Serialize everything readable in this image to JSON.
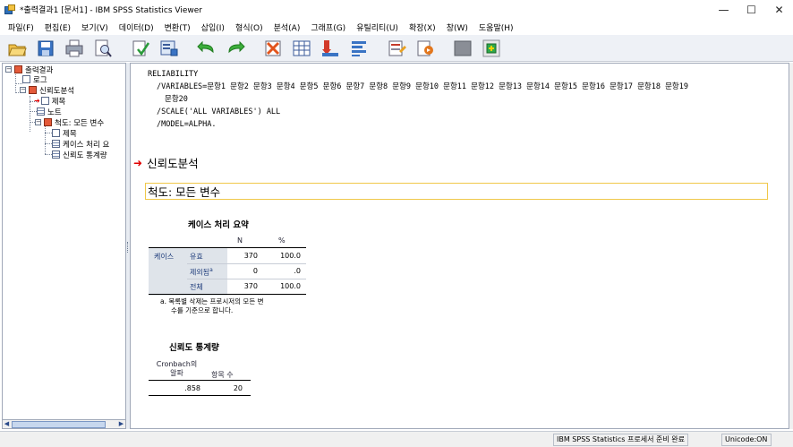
{
  "window": {
    "title": "*출력결과1 [문서1] - IBM SPSS Statistics Viewer",
    "minimize": "—",
    "maximize": "☐",
    "close": "✕"
  },
  "menu": [
    "파일(F)",
    "편집(E)",
    "보기(V)",
    "데이터(D)",
    "변환(T)",
    "삽입(I)",
    "형식(O)",
    "분석(A)",
    "그래프(G)",
    "유틸리티(U)",
    "확장(X)",
    "창(W)",
    "도움말(H)"
  ],
  "toolbar": {
    "icons": [
      "open-icon",
      "save-icon",
      "print-icon",
      "print-preview-icon",
      "export-icon",
      "recall-dialog-icon",
      "undo-icon",
      "redo-icon",
      "goto-data-icon",
      "goto-case-icon",
      "goto-variable-icon",
      "variables-icon",
      "insert-heading-icon",
      "insert-title-icon",
      "show-hide-icon",
      "designate-window-icon"
    ]
  },
  "nav": {
    "root": "출력결과",
    "log": "로그",
    "analysis": "신뢰도분석",
    "title": "제목",
    "notes": "노트",
    "scale": "척도: 모든 변수",
    "scale_title": "제목",
    "case_summary": "케이스 처리 요",
    "reliability_stats": "신뢰도 통계량"
  },
  "syntax": {
    "line1": "RELIABILITY",
    "line2": "/VARIABLES=문항1 문항2 문항3 문항4 문항5 문항6 문항7 문항8 문항9 문항10 문항11 문항12 문항13 문항14 문항15 문항16 문항17 문항18 문항19",
    "line3": "문항20",
    "line4": "/SCALE('ALL VARIABLES') ALL",
    "line5": "/MODEL=ALPHA."
  },
  "output": {
    "heading": "신뢰도분석",
    "scale_heading": "척도: 모든 변수",
    "case_table": {
      "title": "케이스 처리 요약",
      "col_n": "N",
      "col_pct": "%",
      "group_label": "케이스",
      "rows": [
        {
          "label": "유효",
          "n": "370",
          "pct": "100.0"
        },
        {
          "label": "제외됨",
          "superscript": "a",
          "n": "0",
          "pct": ".0"
        },
        {
          "label": "전체",
          "n": "370",
          "pct": "100.0"
        }
      ],
      "footnote_line1": "a. 목록별 삭제는 프로시저의 모든 변",
      "footnote_line2": "수를 기준으로 합니다."
    },
    "reliability_table": {
      "title": "신뢰도 통계량",
      "col_alpha_line1": "Cronbach의",
      "col_alpha_line2": "알파",
      "col_items": "항목 수",
      "alpha": ".858",
      "items": "20"
    }
  },
  "status": {
    "processor": "IBM SPSS Statistics 프로세서 준비 완료",
    "unicode": "Unicode:ON"
  }
}
